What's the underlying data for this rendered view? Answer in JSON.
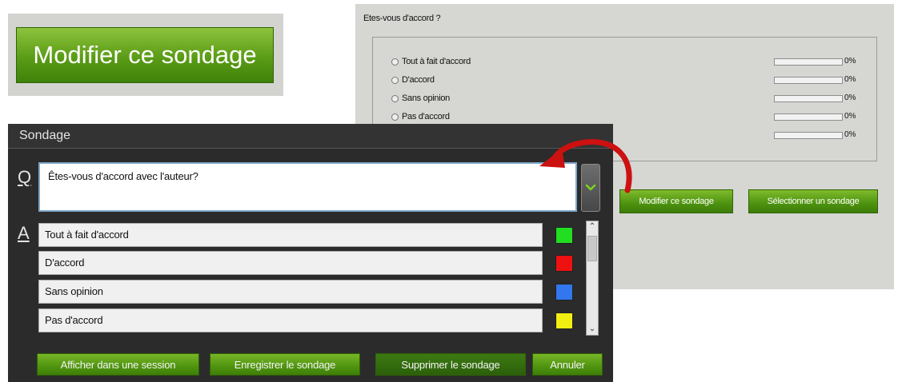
{
  "edit_banner": {
    "label": "Modifier ce sondage"
  },
  "preview": {
    "question": "Etes-vous d'accord ?",
    "rows": [
      {
        "label": "Tout à fait d'accord",
        "percent": "0%",
        "value": 0
      },
      {
        "label": "D'accord",
        "percent": "0%",
        "value": 0
      },
      {
        "label": "Sans opinion",
        "percent": "0%",
        "value": 0
      },
      {
        "label": "Pas d'accord",
        "percent": "0%",
        "value": 0
      },
      {
        "label": "",
        "percent": "0%",
        "value": 0
      }
    ],
    "buttons": {
      "edit": "Modifier ce sondage",
      "select": "Sélectionner un sondage"
    }
  },
  "dialog": {
    "title": "Sondage",
    "q_letter": "Q",
    "a_letter": "A",
    "question_value": "Êtes-vous d'accord avec l'auteur?",
    "answers": [
      {
        "label": "Tout à fait d'accord",
        "color": "#22dd22"
      },
      {
        "label": "D'accord",
        "color": "#ee1111"
      },
      {
        "label": "Sans opinion",
        "color": "#3377ee"
      },
      {
        "label": "Pas d'accord",
        "color": "#f2ee11"
      }
    ],
    "buttons": {
      "show": "Afficher dans une session",
      "save": "Enregistrer le sondage",
      "delete": "Supprimer le sondage",
      "cancel": "Annuler"
    }
  },
  "colors": {
    "accent_green": "#5a9c16",
    "arrow_red": "#cc1111"
  },
  "icons": {
    "dropdown": "chevron-down-icon",
    "arrow": "curved-arrow-icon"
  }
}
